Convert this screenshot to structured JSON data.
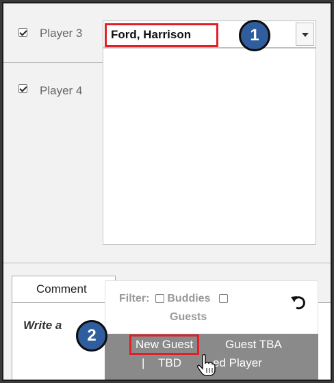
{
  "players": [
    {
      "label": "Player 3",
      "checked": true,
      "value": "Ford, Harrison"
    },
    {
      "label": "Player 4",
      "checked": true,
      "value": ""
    }
  ],
  "annotations": [
    "1",
    "2"
  ],
  "comment": {
    "tab_label": "Comment",
    "placeholder": "Write a"
  },
  "filter": {
    "label": "Filter:",
    "buddies_label": "Buddies",
    "guests_label": "Guests"
  },
  "guest_options": {
    "new_guest": "New Guest",
    "guest_tba": "Guest TBA",
    "separator": "|",
    "tbd": "TBD",
    "named_player": "ed Player"
  },
  "colors": {
    "highlight_red": "#e01f26",
    "badge_blue": "#2f5d9e",
    "guest_bar_gray": "#8a8a8a"
  },
  "icons": [
    "checkbox-checked-icon",
    "chevron-down-icon",
    "undo-icon",
    "hand-pointer-icon"
  ]
}
